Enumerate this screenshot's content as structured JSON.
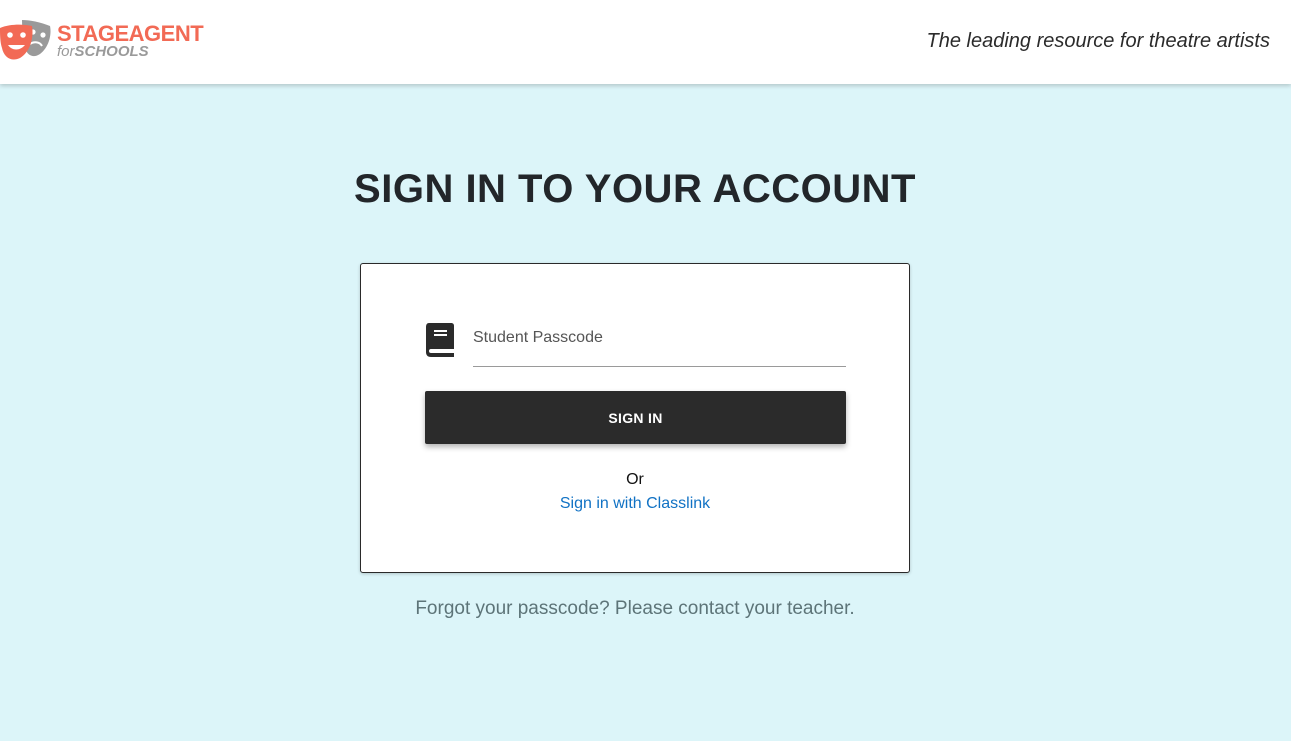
{
  "header": {
    "brand_name": "STAGEAGENT",
    "brand_for": "for",
    "brand_schools": "SCHOOLS",
    "tagline": "The leading resource for theatre artists"
  },
  "main": {
    "title": "SIGN IN TO YOUR ACCOUNT",
    "form": {
      "passcode_placeholder": "Student Passcode",
      "passcode_value": "",
      "signin_label": "SIGN IN",
      "or_text": "Or",
      "classlink_label": "Sign in with Classlink"
    },
    "forgot_text": "Forgot your passcode? Please contact your teacher."
  },
  "icons": {
    "logo": "theatre-masks-icon",
    "passcode": "book-icon"
  },
  "colors": {
    "brand": "#f26a55",
    "background": "#dcf5f9",
    "button": "#2b2b2b",
    "link": "#1172c4"
  }
}
